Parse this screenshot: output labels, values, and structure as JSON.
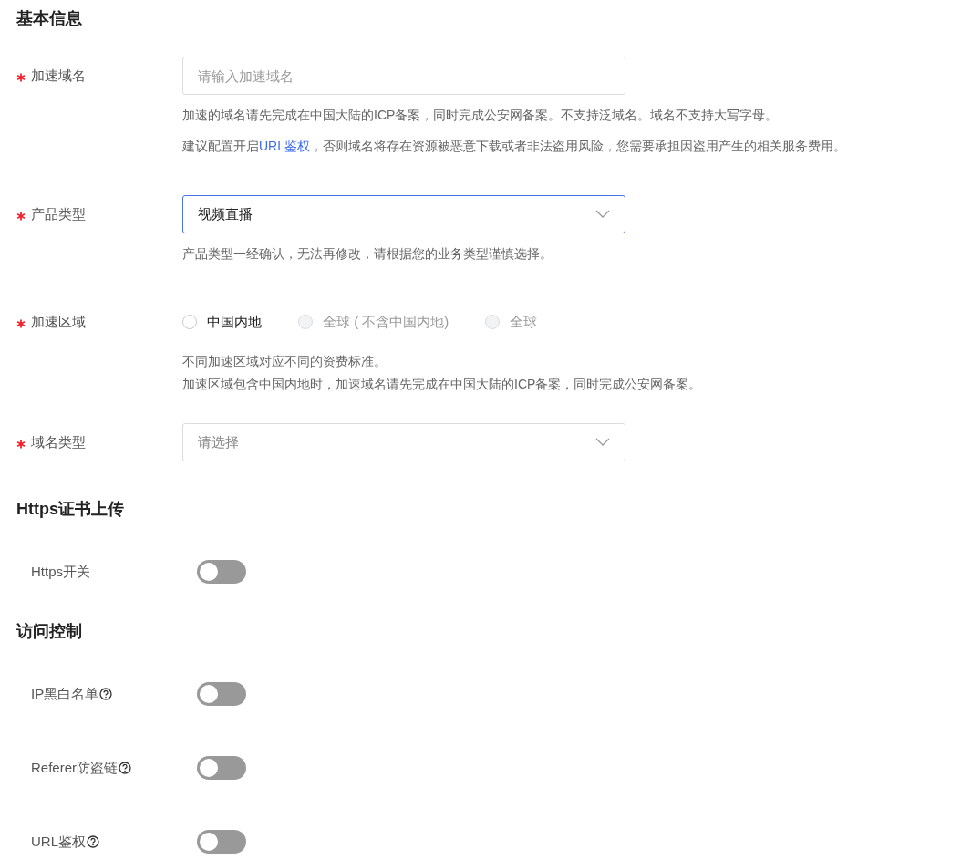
{
  "sections": [
    {
      "title": "基本信息",
      "fields": [
        {
          "kind": "input",
          "label": "加速域名",
          "required": true,
          "placeholder": "请输入加速域名",
          "hints": [
            {
              "text": "加速的域名请先完成在中国大陆的ICP备案，同时完成公安网备案。不支持泛域名。域名不支持大写字母。"
            },
            {
              "text": "建议配置开启",
              "link": "URL鉴权",
              "after": "，否则域名将存在资源被恶意下载或者非法盗用风险，您需要承担因盗用产生的相关服务费用。"
            }
          ]
        },
        {
          "kind": "select",
          "label": "产品类型",
          "required": true,
          "value": "视频直播",
          "focused": true,
          "hints": [
            {
              "text": "产品类型一经确认，无法再修改，请根据您的业务类型谨慎选择。"
            }
          ]
        },
        {
          "kind": "radio",
          "label": "加速区域",
          "required": true,
          "options": [
            {
              "label": "中国内地",
              "selected": false,
              "disabled": false
            },
            {
              "label": "全球 ( 不含中国内地)",
              "selected": false,
              "disabled": true
            },
            {
              "label": "全球",
              "selected": false,
              "disabled": true
            }
          ],
          "hints": [
            {
              "text": "不同加速区域对应不同的资费标准。"
            },
            {
              "text": "加速区域包含中国内地时，加速域名请先完成在中国大陆的ICP备案，同时完成公安网备案。"
            }
          ]
        },
        {
          "kind": "select",
          "label": "域名类型",
          "required": true,
          "placeholder": "请选择",
          "focused": false
        }
      ]
    },
    {
      "title": "Https证书上传",
      "fields": [
        {
          "kind": "switch",
          "label": "Https开关",
          "required": false,
          "help": false,
          "on": false
        }
      ]
    },
    {
      "title": "访问控制",
      "fields": [
        {
          "kind": "switch",
          "label": "IP黑白名单",
          "required": false,
          "help": true,
          "on": false
        },
        {
          "kind": "switch",
          "label": "Referer防盗链",
          "required": false,
          "help": true,
          "on": false
        },
        {
          "kind": "switch",
          "label": "URL鉴权",
          "required": false,
          "help": true,
          "on": false
        }
      ]
    }
  ]
}
